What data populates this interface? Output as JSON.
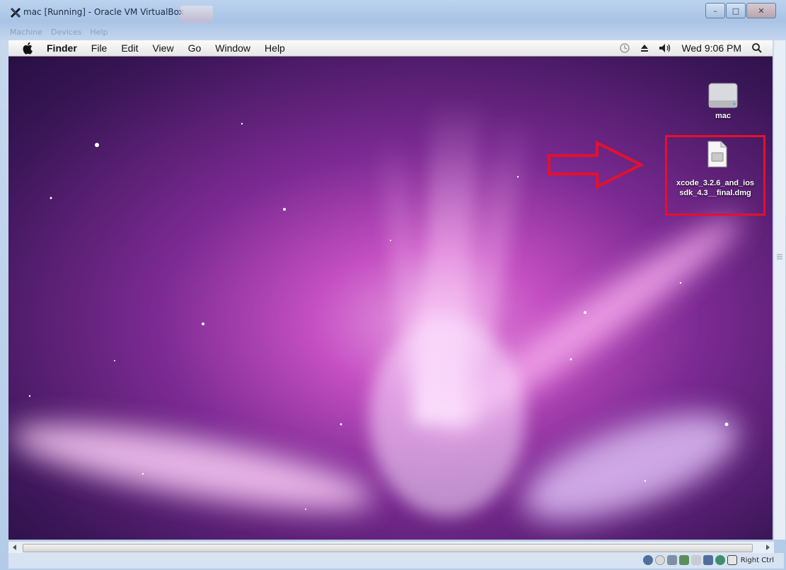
{
  "window": {
    "title": "mac [Running] - Oracle VM VirtualBox",
    "buttons": {
      "minimize": "–",
      "maximize": "□",
      "close": "✕"
    }
  },
  "vbox_menu": [
    "Machine",
    "Devices",
    "Help"
  ],
  "mac_menu": {
    "app": "Finder",
    "items": [
      "File",
      "Edit",
      "View",
      "Go",
      "Window",
      "Help"
    ],
    "clock": "Wed 9:06 PM"
  },
  "desktop": {
    "drive_label": "mac",
    "dmg_label_line1": "xcode_3.2.6_and_ios",
    "dmg_label_line2": "sdk_4.3__final.dmg"
  },
  "statusbar": {
    "host_key": "Right Ctrl"
  },
  "colors": {
    "highlight": "#e5102b",
    "wallpaper": "#3a1550"
  }
}
